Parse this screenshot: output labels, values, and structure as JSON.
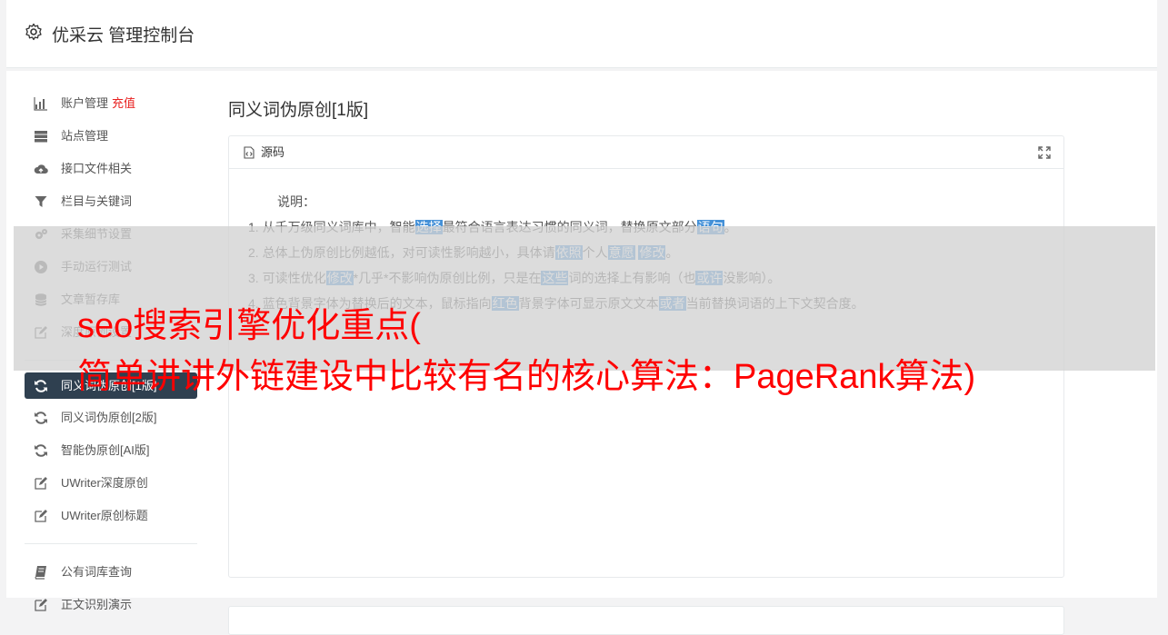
{
  "header": {
    "title": "优采云 管理控制台"
  },
  "sidebar": {
    "items": [
      {
        "label": "账户管理",
        "badge": "充值",
        "icon": "bar-chart-icon"
      },
      {
        "label": "站点管理",
        "icon": "server-icon"
      },
      {
        "label": "接口文件相关",
        "icon": "cloud-upload-icon"
      },
      {
        "label": "栏目与关键词",
        "icon": "filter-icon"
      },
      {
        "label": "采集细节设置",
        "icon": "gears-icon"
      },
      {
        "label": "手动运行测试",
        "icon": "play-circle-icon"
      },
      {
        "label": "文章暂存库",
        "icon": "database-icon"
      },
      {
        "label": "深度原创设置",
        "icon": "edit-icon"
      }
    ],
    "group2": [
      {
        "label": "同义词伪原创[1版]",
        "icon": "refresh-icon",
        "active": true
      },
      {
        "label": "同义词伪原创[2版]",
        "icon": "refresh-icon"
      },
      {
        "label": "智能伪原创[AI版]",
        "icon": "refresh-icon"
      },
      {
        "label": "UWriter深度原创",
        "icon": "edit-icon"
      },
      {
        "label": "UWriter原创标题",
        "icon": "edit-icon"
      }
    ],
    "group3": [
      {
        "label": "公有词库查询",
        "icon": "book-icon"
      },
      {
        "label": "正文识别演示",
        "icon": "edit-icon"
      }
    ]
  },
  "main": {
    "page_title": "同义词伪原创[1版]",
    "panel": {
      "header_label": "源码",
      "notes_heading": "说明：",
      "notes": [
        [
          "1. 从千万级同义词库中，智能",
          {
            "hl": "选择"
          },
          "最符合语言表达习惯的同义词，替换原文部分",
          {
            "hl": "语句"
          },
          "。"
        ],
        [
          "2. 总体上伪原创比例越低，对可读性影响越小，具体请",
          {
            "hl": "依照"
          },
          "个人",
          {
            "hl": "意愿"
          },
          " ",
          {
            "hl": "修改"
          },
          "。"
        ],
        [
          "3. 可读性优化",
          {
            "hl": "修改"
          },
          "*几乎*不影响伪原创比例，只是在",
          {
            "hl": "这些"
          },
          "词的选择上有影响（也",
          {
            "hl": "或许"
          },
          "没影响）。"
        ],
        [
          "4. 蓝色背景字体为替换后的文本，鼠标指向",
          {
            "hl": "红色"
          },
          "背景字体可显示原文文本",
          {
            "hl": "或者"
          },
          "当前替换词语的上下文契合度。"
        ]
      ]
    }
  },
  "overlay": {
    "line1": "seo搜索引擎优化重点(",
    "line2": "简单讲讲外链建设中比较有名的核心算法：PageRank算法)"
  },
  "colors": {
    "highlight": "#4591d8",
    "active_nav": "#2f4050",
    "badge": "#e8201f",
    "overlay_text": "#ff0000"
  }
}
